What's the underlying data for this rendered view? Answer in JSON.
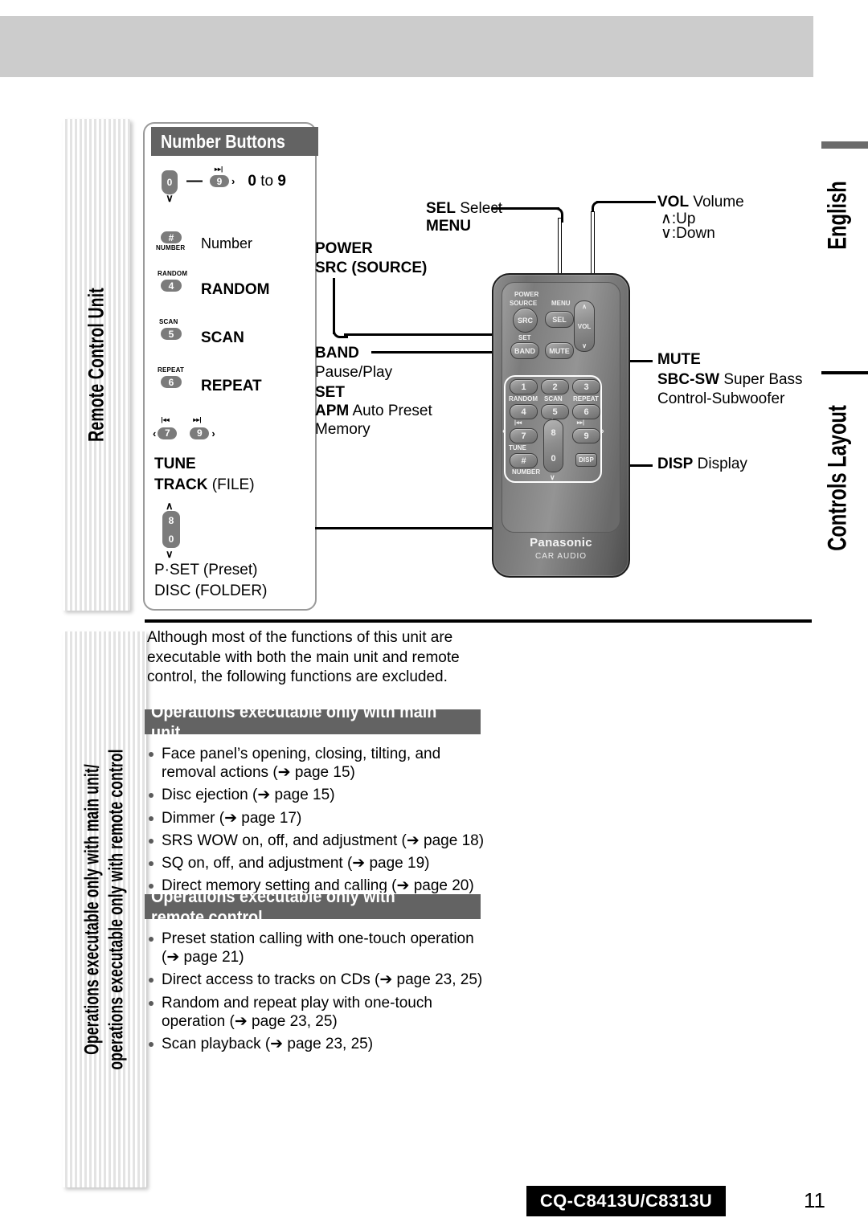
{
  "page": {
    "language_tab": "English",
    "section_tab": "Controls Layout",
    "left_tab_top": "Remote Control Unit",
    "left_tab_bottom_line1": "Operations executable only with main unit/",
    "left_tab_bottom_line2": "operations executable only with remote control",
    "footer_model": "CQ-C8413U/C8313U",
    "footer_page": "11"
  },
  "number_card": {
    "title": "Number Buttons",
    "rows": [
      {
        "key_left": "0",
        "dash": "—",
        "key_right": "9",
        "glyph_right": "▸▸|",
        "chevron": "›",
        "text": "0 to 9",
        "bold_first": "0",
        "mid": " to ",
        "bold_last": "9"
      },
      {
        "key": "#",
        "key_sub": "NUMBER",
        "text": "Number"
      },
      {
        "key": "4",
        "key_sub": "RANDOM",
        "text": "RANDOM"
      },
      {
        "key": "5",
        "key_sub": "SCAN",
        "text": "SCAN"
      },
      {
        "key": "6",
        "key_sub": "REPEAT",
        "text": "REPEAT"
      }
    ],
    "seek_row": {
      "left_chevron": "‹",
      "key_left": "7",
      "glyph_left": "|◂◂",
      "key_right": "9",
      "glyph_right": "▸▸|",
      "right_chevron": "›"
    },
    "tune_label": "TUNE",
    "track_label_bold": "TRACK",
    "track_label_rest": " (FILE)",
    "rocker": {
      "up": "∧",
      "top": "8",
      "bottom": "0",
      "down": "∨"
    },
    "pset_label": "P·SET (Preset)",
    "disc_label": "DISC (FOLDER)"
  },
  "callouts": {
    "sel_bold": "SEL",
    "sel_rest": " Select",
    "menu": "MENU",
    "power": "POWER",
    "src": "SRC (SOURCE)",
    "band": "BAND",
    "pause_play": "Pause/Play",
    "set": "SET",
    "apm_bold": "APM",
    "apm_rest": " Auto Preset",
    "memory": "Memory",
    "vol_bold": "VOL",
    "vol_rest": " Volume",
    "vol_up": "∧:Up",
    "vol_down": "∨:Down",
    "mute": "MUTE",
    "sbc_bold": "SBC-SW",
    "sbc_rest": " Super Bass",
    "sbc_line2": "Control-Subwoofer",
    "disp_bold": "DISP",
    "disp_rest": " Display"
  },
  "remote": {
    "power_label": "POWER",
    "source_label": "SOURCE",
    "menu_label": "MENU",
    "set_label": "SET",
    "src_button": "SRC",
    "sel_button": "SEL",
    "band_button": "BAND",
    "mute_button": "MUTE",
    "vol_label": "VOL",
    "vol_up_glyph": "∧",
    "vol_down_glyph": "∨",
    "keys": [
      "1",
      "2",
      "3",
      "4",
      "5",
      "6",
      "7",
      "8",
      "9",
      "0",
      "#"
    ],
    "random_label": "RANDOM",
    "scan_label": "SCAN",
    "repeat_label": "REPEAT",
    "prev_glyph": "|◂◂",
    "next_glyph": "▸▸|",
    "up_glyph": "∧",
    "down_glyph": "∨",
    "left_glyph": "‹",
    "right_glyph": "›",
    "tune_label": "TUNE",
    "number_label": "NUMBER",
    "disp_button": "DISP",
    "brand": "Panasonic",
    "brand_sub": "CAR AUDIO"
  },
  "body": {
    "intro": "Although most of the functions of this unit are executable with both the main unit and remote control, the following functions are excluded.",
    "main_unit_title": "Operations executable only with main unit",
    "main_unit_items": [
      "Face panel’s opening, closing, tilting, and removal actions (➔ page 15)",
      "Disc ejection (➔ page 15)",
      "Dimmer (➔ page 17)",
      "SRS WOW on, off, and adjustment (➔ page 18)",
      "SQ on, off, and adjustment (➔ page 19)",
      "Direct memory setting and calling (➔ page 20)"
    ],
    "remote_title": "Operations executable only with remote control",
    "remote_items": [
      "Preset station calling with one-touch operation (➔ page 21)",
      "Direct access to tracks on CDs (➔ page 23, 25)",
      "Random and repeat play with one-touch operation (➔ page 23, 25)",
      "Scan playback (➔ page 23, 25)"
    ]
  },
  "colors": {
    "section_bar": "#636363",
    "top_band": "#cccccc",
    "footer_box": "#000000"
  }
}
